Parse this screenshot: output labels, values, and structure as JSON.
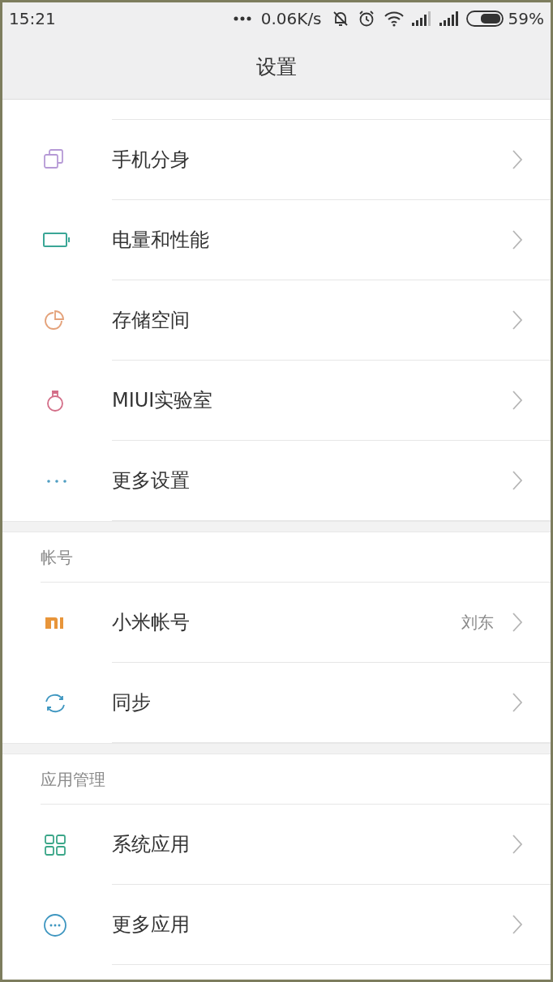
{
  "status_bar": {
    "time": "15:21",
    "network_speed": "0.06K/s",
    "battery": "59%"
  },
  "title": "设置",
  "sections": [
    {
      "items": [
        {
          "label": "手机分身"
        },
        {
          "label": "电量和性能"
        },
        {
          "label": "存储空间"
        },
        {
          "label": "MIUI实验室"
        },
        {
          "label": "更多设置"
        }
      ]
    },
    {
      "header": "帐号",
      "items": [
        {
          "label": "小米帐号",
          "value": "刘东"
        },
        {
          "label": "同步"
        }
      ]
    },
    {
      "header": "应用管理",
      "items": [
        {
          "label": "系统应用"
        },
        {
          "label": "更多应用"
        }
      ]
    }
  ]
}
